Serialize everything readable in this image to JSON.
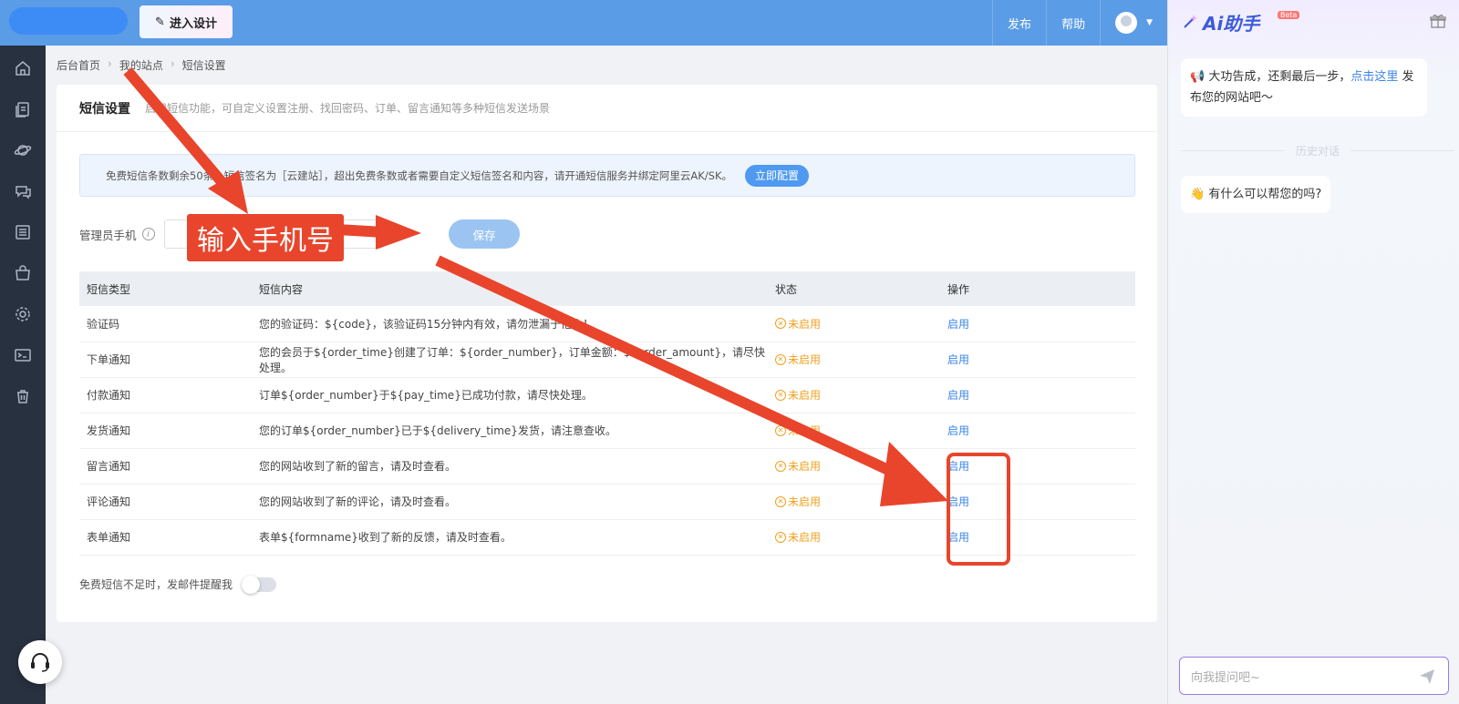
{
  "topbar": {
    "design_button": "进入设计",
    "publish": "发布",
    "help": "帮助"
  },
  "breadcrumb": [
    "后台首页",
    "我的站点",
    "短信设置"
  ],
  "card": {
    "title": "短信设置",
    "description": "启用短信功能，可自定义设置注册、找回密码、订单、留言通知等多种短信发送场景"
  },
  "notice": {
    "text": "免费短信条数剩余50条，短信签名为［云建站］，超出免费条数或者需要自定义短信签名和内容，请开通短信服务并绑定阿里云AK/SK。",
    "button": "立即配置"
  },
  "admin_phone": {
    "label": "管理员手机",
    "value": "",
    "save_button": "保存"
  },
  "table": {
    "headers": [
      "短信类型",
      "短信内容",
      "状态",
      "操作"
    ],
    "rows": [
      {
        "type": "验证码",
        "content": "您的验证码：${code}，该验证码15分钟内有效，请勿泄漏于他人！",
        "status": "未启用",
        "action": "启用"
      },
      {
        "type": "下单通知",
        "content": "您的会员于${order_time}创建了订单：${order_number}，订单金额：${order_amount}，请尽快处理。",
        "status": "未启用",
        "action": "启用"
      },
      {
        "type": "付款通知",
        "content": "订单${order_number}于${pay_time}已成功付款，请尽快处理。",
        "status": "未启用",
        "action": "启用"
      },
      {
        "type": "发货通知",
        "content": "您的订单${order_number}已于${delivery_time}发货，请注意查收。",
        "status": "未启用",
        "action": "启用"
      },
      {
        "type": "留言通知",
        "content": "您的网站收到了新的留言，请及时查看。",
        "status": "未启用",
        "action": "启用"
      },
      {
        "type": "评论通知",
        "content": "您的网站收到了新的评论，请及时查看。",
        "status": "未启用",
        "action": "启用"
      },
      {
        "type": "表单通知",
        "content": "表单${formname}收到了新的反馈，请及时查看。",
        "status": "未启用",
        "action": "启用"
      }
    ]
  },
  "email_reminder": {
    "label": "免费短信不足时，发邮件提醒我",
    "enabled": false
  },
  "ai_panel": {
    "title": "Ai助手",
    "badge": "Beta",
    "bubble1_text": "大功告成，还剩最后一步，",
    "bubble1_link": "点击这里",
    "bubble1_suffix": "发布您的网站吧～",
    "history_label": "历史对话",
    "bubble2_text": "有什么可以帮您的吗?",
    "input_placeholder": "向我提问吧~"
  },
  "annotation": {
    "label": "输入手机号",
    "color": "#e8452c"
  }
}
